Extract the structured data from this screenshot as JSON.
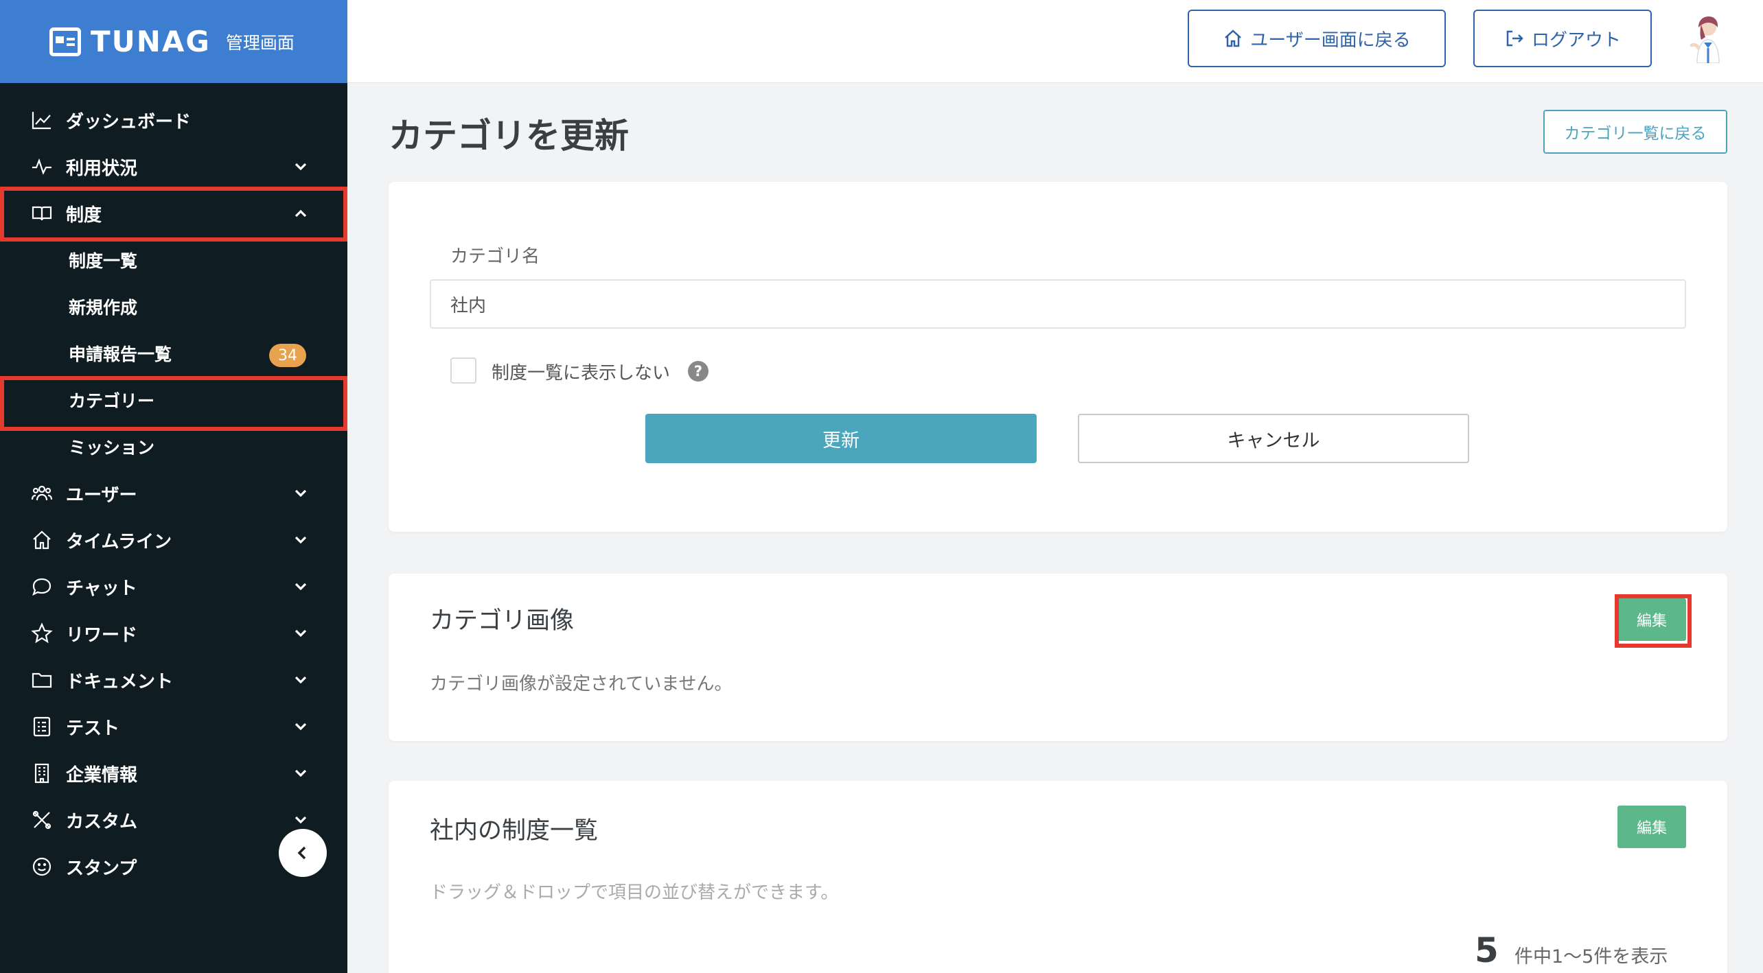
{
  "brand": {
    "name": "TUNAG",
    "sub": "管理画面"
  },
  "nav": {
    "dashboard": "ダッシュボード",
    "usage": "利用状況",
    "system": "制度",
    "system_list": "制度一覧",
    "new": "新規作成",
    "reports": "申請報告一覧",
    "reports_badge": "34",
    "category": "カテゴリー",
    "mission": "ミッション",
    "users": "ユーザー",
    "timeline": "タイムライン",
    "chat": "チャット",
    "reward": "リワード",
    "document": "ドキュメント",
    "test": "テスト",
    "company": "企業情報",
    "custom": "カスタム",
    "stamp": "スタンプ"
  },
  "topbar": {
    "user_screen": "ユーザー画面に戻る",
    "logout": "ログアウト"
  },
  "page": {
    "title": "カテゴリを更新",
    "back": "カテゴリ一覧に戻る"
  },
  "form": {
    "label": "カテゴリ名",
    "value": "社内",
    "hide_label": "制度一覧に表示しない",
    "help": "?",
    "submit": "更新",
    "cancel": "キャンセル"
  },
  "image_card": {
    "title": "カテゴリ画像",
    "edit": "編集",
    "empty": "カテゴリ画像が設定されていません。"
  },
  "list_card": {
    "title": "社内の制度一覧",
    "edit": "編集",
    "hint": "ドラッグ＆ドロップで項目の並び替えができます。",
    "count": "5",
    "range": "件中1〜5件を表示"
  },
  "colors": {
    "brand": "#3d7ed1",
    "sidebar": "#0f1c22",
    "highlight": "#e53a2d",
    "primary": "#4aa6bd",
    "edit": "#5cb88a",
    "badge": "#e8a24d"
  }
}
